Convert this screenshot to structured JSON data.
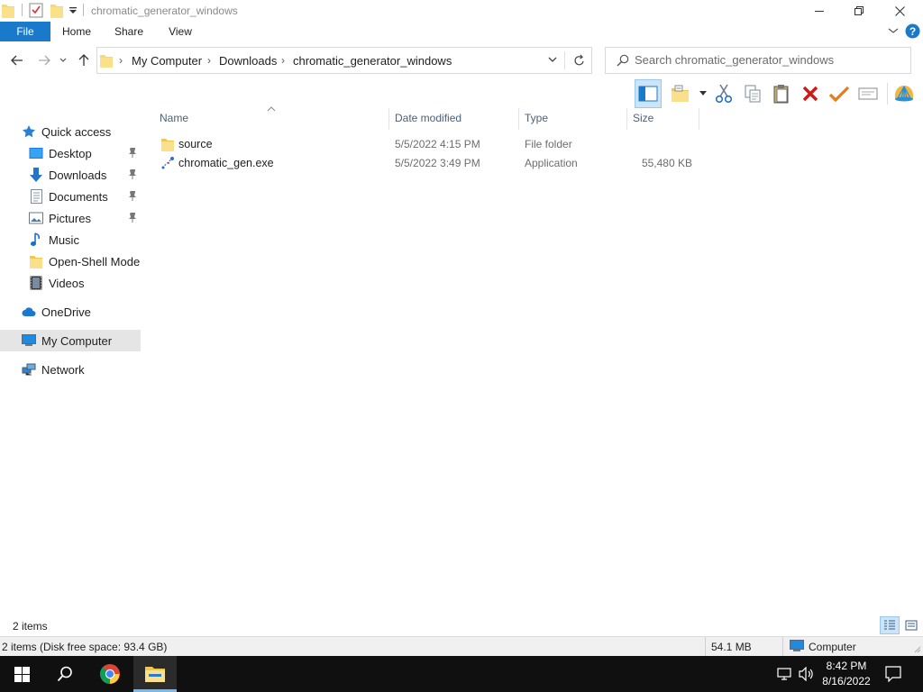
{
  "window": {
    "title": "chromatic_generator_windows"
  },
  "ribbon": {
    "tabs": [
      {
        "label": "File"
      },
      {
        "label": "Home"
      },
      {
        "label": "Share"
      },
      {
        "label": "View"
      }
    ]
  },
  "address": {
    "crumbs": [
      "My Computer",
      "Downloads",
      "chromatic_generator_windows"
    ]
  },
  "search": {
    "placeholder": "Search chromatic_generator_windows"
  },
  "nav": {
    "items": [
      {
        "label": "Quick access",
        "icon": "star-icon"
      },
      {
        "label": "Desktop",
        "icon": "desktop-icon",
        "pinned": true
      },
      {
        "label": "Downloads",
        "icon": "download-arrow-icon",
        "pinned": true
      },
      {
        "label": "Documents",
        "icon": "document-icon",
        "pinned": true
      },
      {
        "label": "Pictures",
        "icon": "pictures-icon",
        "pinned": true
      },
      {
        "label": "Music",
        "icon": "music-note-icon"
      },
      {
        "label": "Open-Shell Modern",
        "icon": "folder-icon"
      },
      {
        "label": "Videos",
        "icon": "film-icon"
      },
      {
        "label": "OneDrive",
        "icon": "cloud-icon"
      },
      {
        "label": "My Computer",
        "icon": "computer-icon",
        "selected": true
      },
      {
        "label": "Network",
        "icon": "network-icon"
      }
    ]
  },
  "columns": {
    "name": "Name",
    "date": "Date modified",
    "type": "Type",
    "size": "Size"
  },
  "files": [
    {
      "name": "source",
      "date": "5/5/2022 4:15 PM",
      "type": "File folder",
      "size": "",
      "icon": "folder-icon"
    },
    {
      "name": "chromatic_gen.exe",
      "date": "5/5/2022 3:49 PM",
      "type": "Application",
      "size": "55,480 KB",
      "icon": "application-icon"
    }
  ],
  "status": {
    "item_count": "2 items",
    "disk_info": "2 items (Disk free space: 93.4 GB)",
    "selection_size": "54.1 MB",
    "location": "Computer"
  },
  "clock": {
    "time": "8:42 PM",
    "date": "8/16/2022"
  },
  "colors": {
    "accent": "#1979ca",
    "selected_nav": "#e5e5e5",
    "taskbar": "#101010"
  }
}
